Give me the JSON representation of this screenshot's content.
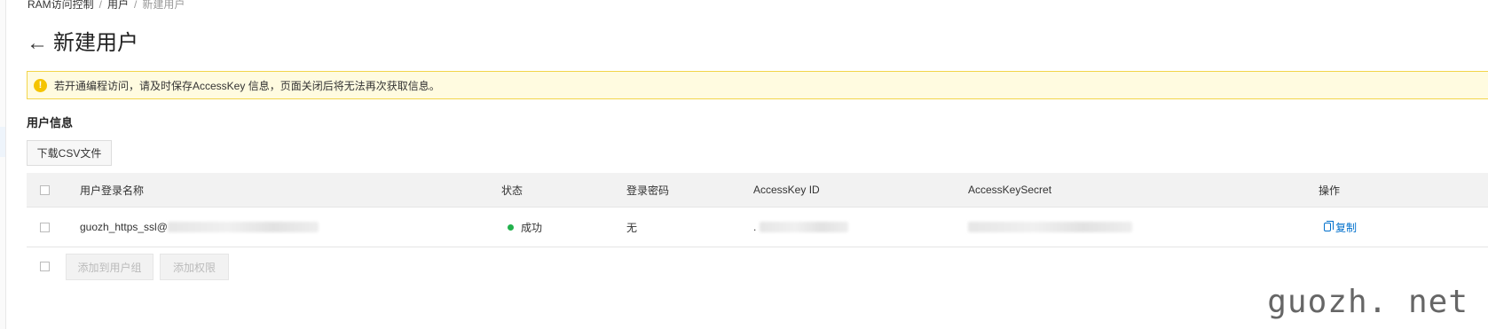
{
  "breadcrumb": {
    "root": "RAM访问控制",
    "sep": "/",
    "parent": "用户",
    "current": "新建用户"
  },
  "page": {
    "back_icon": "arrow-left-icon",
    "title": "新建用户"
  },
  "notice": {
    "icon": "warning-icon",
    "text": "若开通编程访问，请及时保存AccessKey 信息，页面关闭后将无法再次获取信息。",
    "bg_color": "#fffbe0",
    "border_color": "#f2d54b"
  },
  "section": {
    "title": "用户信息"
  },
  "toolbar": {
    "download_label": "下载CSV文件"
  },
  "table": {
    "columns": [
      "用户登录名称",
      "状态",
      "登录密码",
      "AccessKey ID",
      "AccessKeySecret",
      "操作"
    ],
    "rows": [
      {
        "login_name": "guozh_https_ssl@",
        "status": "成功",
        "status_color": "#22b14c",
        "password": "无",
        "accesskey_id": ".",
        "accesskey_secret": "",
        "action": "复制"
      }
    ]
  },
  "footer": {
    "add_to_group_label": "添加到用户组",
    "add_permission_label": "添加权限"
  },
  "watermark": {
    "text": "guozh. net"
  },
  "colors": {
    "link": "#0070cc",
    "header_bg": "#f2f2f2"
  }
}
